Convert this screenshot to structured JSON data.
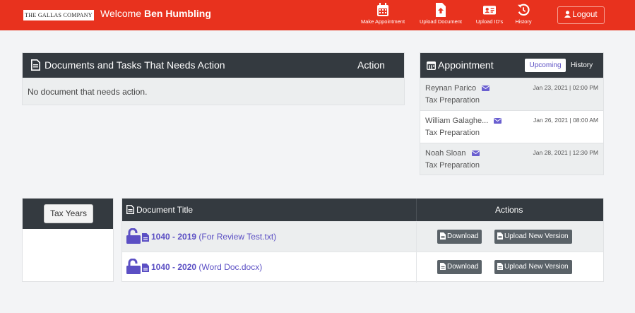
{
  "header": {
    "logo_text": "THE GALLAS COMPANY",
    "welcome_prefix": "Welcome",
    "user_name": "Ben Humbling",
    "nav": [
      {
        "label": "Make Appointment",
        "icon": "calendar-icon"
      },
      {
        "label": "Upload Document",
        "icon": "upload-document-icon"
      },
      {
        "label": "Upload ID's",
        "icon": "id-card-icon"
      },
      {
        "label": "History",
        "icon": "history-icon"
      }
    ],
    "logout_label": "Logout"
  },
  "documents_panel": {
    "title": "Documents and Tasks That Needs Action",
    "action_header": "Action",
    "empty_message": "No document that needs action."
  },
  "appointment_panel": {
    "title": "Appointment",
    "tabs": [
      "Upcoming",
      "History"
    ],
    "active_tab": "Upcoming",
    "items": [
      {
        "name": "Reynan Parico",
        "service": "Tax Preparation",
        "datetime": "Jan 23, 2021 | 02:00 PM"
      },
      {
        "name": "William Galaghe...",
        "service": "Tax Preparation",
        "datetime": "Jan 26, 2021 | 08:00 AM"
      },
      {
        "name": "Noah Sloan",
        "service": "Tax Preparation",
        "datetime": "Jan 28, 2021 | 12:30 PM"
      }
    ]
  },
  "tax_years": {
    "button_label": "Tax Years"
  },
  "document_table": {
    "headers": [
      "Document Title",
      "Actions"
    ],
    "rows": [
      {
        "form": "1040 - 2019",
        "file": "(For Review Test.txt)"
      },
      {
        "form": "1040 - 2020",
        "file": "(Word Doc.docx)"
      }
    ],
    "download_label": "Download",
    "upload_label": "Upload New Version"
  },
  "colors": {
    "header_bg": "#e8321e",
    "panel_header": "#343a40",
    "accent_purple": "#5b4fc4",
    "button_gray": "#5a6268"
  }
}
